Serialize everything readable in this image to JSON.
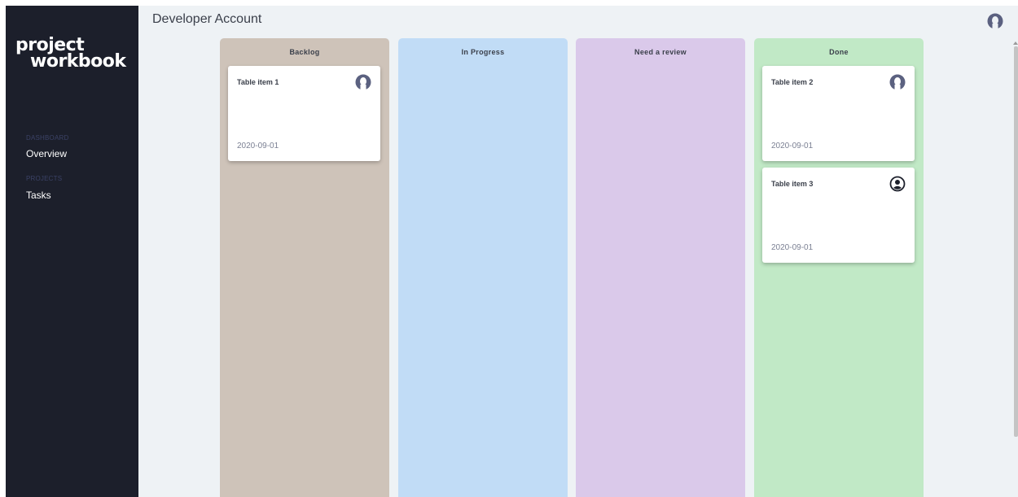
{
  "sidebar": {
    "logo_line1": "project",
    "logo_line2": "workbook",
    "sections": [
      {
        "label": "DASHBOARD",
        "items": [
          {
            "label": "Overview"
          }
        ]
      },
      {
        "label": "PROJECTS",
        "items": [
          {
            "label": "Tasks"
          }
        ]
      }
    ]
  },
  "header": {
    "title": "Developer Account",
    "user_icon": "user-avatar-icon"
  },
  "board": {
    "columns": [
      {
        "title": "Backlog",
        "color": "#cec3b9",
        "cards": [
          {
            "title": "Table item 1",
            "date": "2020-09-01",
            "avatar_icon": "user-avatar-icon"
          }
        ]
      },
      {
        "title": "In Progress",
        "color": "#c1dcf6",
        "cards": []
      },
      {
        "title": "Need a review",
        "color": "#dac9ea",
        "cards": []
      },
      {
        "title": "Done",
        "color": "#c1e9c6",
        "cards": [
          {
            "title": "Table item 2",
            "date": "2020-09-01",
            "avatar_icon": "user-avatar-icon"
          },
          {
            "title": "Table item 3",
            "date": "2020-09-01",
            "avatar_icon": "account-circle-icon"
          }
        ]
      }
    ]
  },
  "colors": {
    "sidebar_bg": "#1c1f2b",
    "main_bg": "#eef2f5",
    "section_label": "#3b4266",
    "avatar": "#5b6180"
  }
}
